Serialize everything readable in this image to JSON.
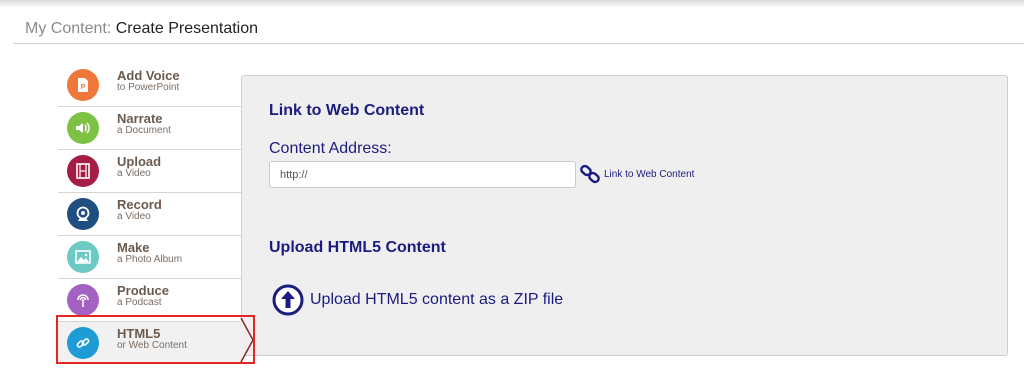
{
  "header": {
    "crumb": "My Content:",
    "current": "Create Presentation"
  },
  "sidebar": {
    "items": [
      {
        "title": "Add Voice",
        "subtitle": "to PowerPoint",
        "icon": "powerpoint-icon",
        "color": "#f0773a"
      },
      {
        "title": "Narrate",
        "subtitle": "a Document",
        "icon": "speaker-icon",
        "color": "#7dc242"
      },
      {
        "title": "Upload",
        "subtitle": "a Video",
        "icon": "film-icon",
        "color": "#a51c44"
      },
      {
        "title": "Record",
        "subtitle": "a Video",
        "icon": "webcam-icon",
        "color": "#1f4f80"
      },
      {
        "title": "Make",
        "subtitle": "a Photo Album",
        "icon": "picture-icon",
        "color": "#6cc9c4"
      },
      {
        "title": "Produce",
        "subtitle": "a Podcast",
        "icon": "podcast-icon",
        "color": "#a361c2"
      },
      {
        "title": "HTML5",
        "subtitle": "or Web Content",
        "icon": "link-icon",
        "color": "#1f9bd6"
      }
    ]
  },
  "panel": {
    "web_title": "Link to Web Content",
    "address_label": "Content Address:",
    "address_value": "http://",
    "link_button_label": "Link to Web Content",
    "upload_title": "Upload HTML5 Content",
    "upload_label": "Upload HTML5 content as a ZIP file"
  },
  "colors": {
    "accent_text": "#1c1c80",
    "highlight": "#e32626",
    "panel_bg": "#efefef"
  }
}
